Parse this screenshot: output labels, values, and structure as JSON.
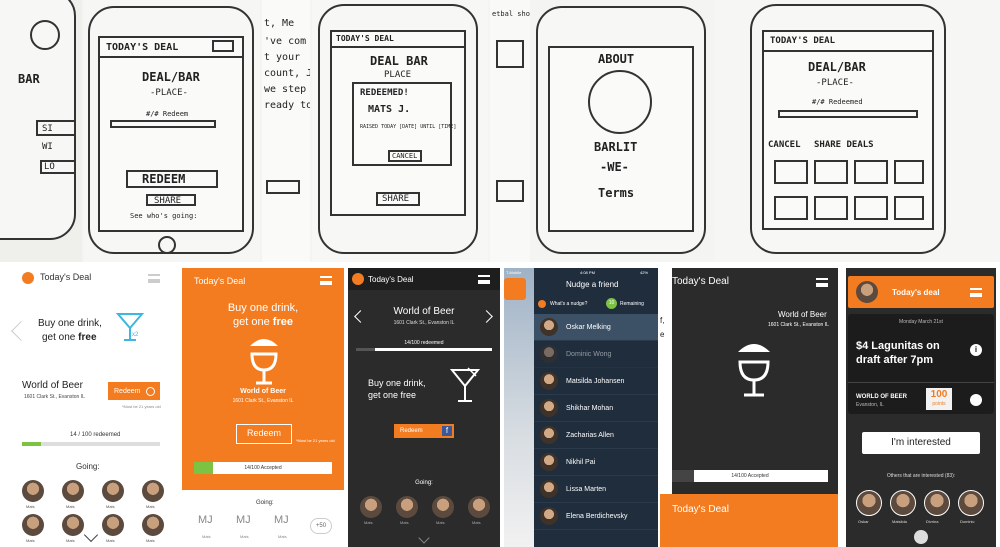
{
  "sketches": {
    "s1": {
      "brand": "BAR",
      "sign": "SI",
      "wi": "WI",
      "lo": "LO"
    },
    "s2": {
      "title": "TODAY'S DEAL",
      "deal": "DEAL/BAR",
      "place": "-PLACE-",
      "redeemed": "#/# Redeem",
      "redeem_btn": "REDEEM",
      "share_btn": "SHARE",
      "whos_going": "See who's going:"
    },
    "s3": {
      "text1": "t, Me",
      "text2": "'ve com",
      "text3": "t your",
      "text4": "count, Jo",
      "text5": "we step",
      "text6": "ready to"
    },
    "s4": {
      "title": "TODAY'S DEAL",
      "deal": "DEAL BAR",
      "place": "PLACE",
      "redeemed": "REDEEMED!",
      "name": "MATS J.",
      "fine": "RAISED TODAY [DATE] UNTIL [TIME]",
      "cancel": "CANCEL",
      "share": "SHARE"
    },
    "s5": {
      "tab": "etbal shot"
    },
    "s6": {
      "about": "ABOUT",
      "brand": "BARLIT",
      "we": "-WE-",
      "terms": "Terms"
    },
    "s7": {
      "title": "TODAY'S DEAL",
      "deal": "DEAL/BAR",
      "place": "-PLACE-",
      "redeemed": "#/# Redeemed",
      "cancel": "CANCEL",
      "share": "SHARE DEALS"
    }
  },
  "m1": {
    "title": "Today's Deal",
    "offer_line1": "Buy one drink,",
    "offer_line2": "get one",
    "offer_bold": "free",
    "multiplier": "x2",
    "bar": "World of Beer",
    "address": "1601 Clark St., Evanston IL",
    "redeem": "Redeem",
    "note": "*Must be 21 years old",
    "progress_text": "14 / 100 redeemed",
    "progress": 0.14,
    "going": "Going:",
    "people": [
      "Mats",
      "Mats",
      "Mats",
      "Mats",
      "Mats",
      "Mats",
      "Mats",
      "Mats"
    ]
  },
  "m2": {
    "title": "Today's Deal",
    "offer_line1": "Buy one drink,",
    "offer_line2": "get one",
    "offer_bold": "free",
    "bar": "World of Beer",
    "address": "1601 Clark St., Evanston IL",
    "redeem": "Redeem",
    "note": "*Must be 21 years old",
    "progress_text": "14/100 Accepted",
    "progress": 0.14,
    "going": "Going:",
    "initials": [
      "MJ",
      "MJ",
      "MJ"
    ],
    "labels": [
      "Mats",
      "Mats",
      "Mats"
    ],
    "more": "+50"
  },
  "m3": {
    "title": "Today's Deal",
    "bar": "World of Beer",
    "address": "1601 Clark St., Evanston IL",
    "progress_text": "14/100 redeemed",
    "progress": 0.14,
    "offer_line1": "Buy one drink,",
    "offer_line2": "get one free",
    "redeem": "Redeem",
    "going": "Going:",
    "people": [
      "Mats",
      "Mats",
      "Mats",
      "Mats"
    ]
  },
  "m4": {
    "carrier": "T-Mobile",
    "time": "4:08 PM",
    "battery": "42%",
    "title": "Nudge a friend",
    "whats": "What's a nudge?",
    "remaining_count": "10",
    "remaining": "Remaining",
    "friends": [
      "Oskar Melking",
      "Dominic Wong",
      "Matsilda Johansen",
      "Shikhar Mohan",
      "Zacharias Allen",
      "Nikhil Pai",
      "Lissa Marten",
      "Elena Berdichevsky"
    ]
  },
  "m5": {
    "title": "Today's Deal",
    "bar": "World of Beer",
    "address": "1601 Clark St., Evanston IL",
    "progress_text": "14/100 Accepted",
    "progress": 0.14,
    "footer": "Today's Deal",
    "peek1": "f,",
    "peek2": "e"
  },
  "m6": {
    "title": "Today's deal",
    "date": "Monday March 21st",
    "deal_line1": "$4 Lagunitas on",
    "deal_line2": "draft after 7pm",
    "bar": "WORLD OF BEER",
    "city": "Evanston, IL",
    "points": "100",
    "points_label": "points",
    "button": "I'm interested",
    "others": "Others that are interested (83):",
    "people": [
      "Oskar",
      "Matsilda",
      "Divrina",
      "Dominic"
    ]
  },
  "colors": {
    "orange": "#f47c20",
    "dark": "#2b2b2b",
    "navy": "#1f2d3d"
  }
}
